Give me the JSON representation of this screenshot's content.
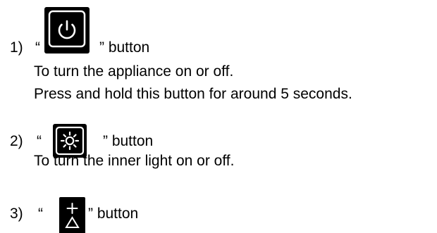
{
  "items": [
    {
      "number": "1)",
      "open_quote": "“",
      "close_text": "” button",
      "icon": "power-icon",
      "description_lines": [
        "To turn the appliance on or off.",
        "Press and hold this button for around 5 seconds."
      ]
    },
    {
      "number": "2)",
      "open_quote": "“",
      "close_text": "” button",
      "icon": "light-icon",
      "description_lines": [
        "To turn the inner light on or off."
      ]
    },
    {
      "number": "3)",
      "open_quote": "“",
      "close_text": "” button",
      "icon": "plus-light-icon",
      "description_lines": []
    }
  ],
  "colors": {
    "text": "#000000",
    "icon_bg": "#000000",
    "icon_fg": "#ffffff"
  }
}
